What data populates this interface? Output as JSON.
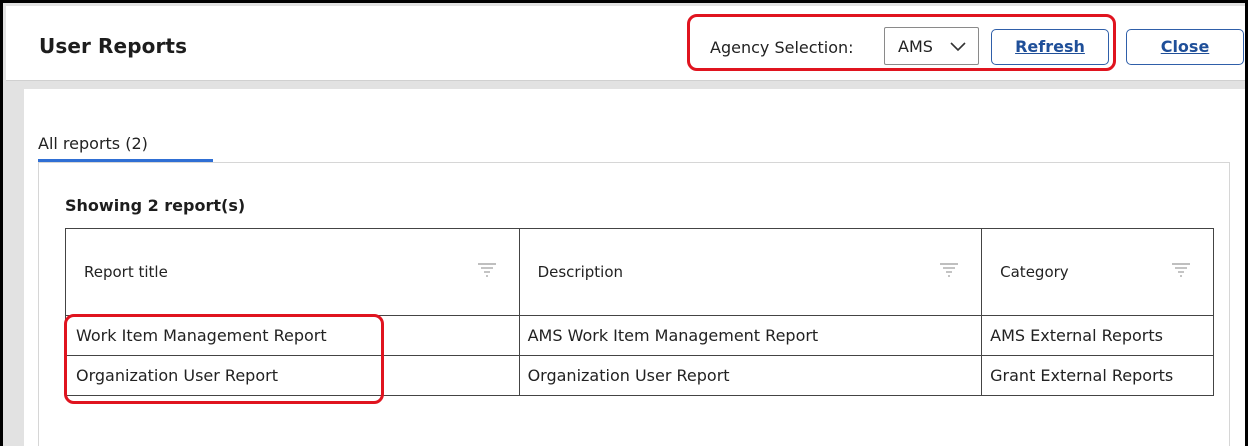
{
  "page": {
    "title": "User Reports"
  },
  "toolbar": {
    "agency_label": "Agency Selection:",
    "agency_value": "AMS",
    "refresh_label": "Refresh",
    "close_label": "Close"
  },
  "tabs": [
    {
      "label": "All reports (2)",
      "active": true
    }
  ],
  "report_list": {
    "showing_text": "Showing 2 report(s)",
    "columns": [
      "Report title",
      "Description",
      "Category"
    ],
    "rows": [
      {
        "title": "Work Item Management Report",
        "description": "AMS Work Item Management Report",
        "category": "AMS External Reports"
      },
      {
        "title": "Organization User Report",
        "description": "Organization User Report",
        "category": "Grant External Reports"
      }
    ]
  },
  "icons": {
    "dropdown": "chevron-down-icon",
    "column_filter": "filter-icon"
  },
  "colors": {
    "accent": "#2f6fd4",
    "button_border": "#2f5fa9",
    "callout": "#e0141f"
  }
}
